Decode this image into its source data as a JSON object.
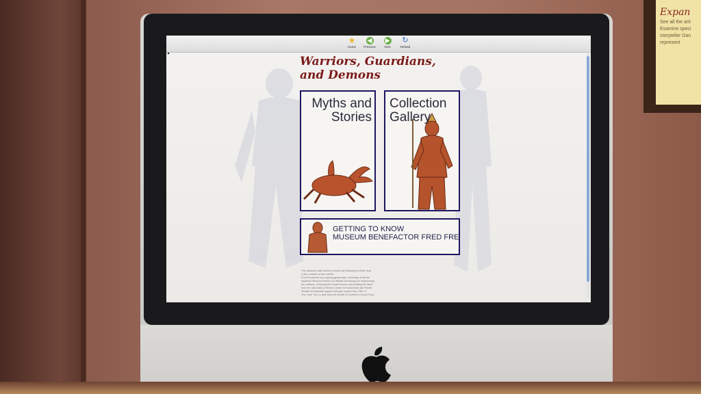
{
  "poster": {
    "title": "Expan",
    "lines": [
      "See all the arti",
      "Examine speci",
      "storyteller Dan",
      "represent"
    ]
  },
  "browser": {
    "toolbar": [
      {
        "label": "Home",
        "icon": "star-icon",
        "color": "#e8b82c"
      },
      {
        "label": "Previous",
        "icon": "back-arrow-icon",
        "color": "#6cb04c"
      },
      {
        "label": "Next",
        "icon": "forward-arrow-icon",
        "color": "#6cb04c"
      },
      {
        "label": "Reload",
        "icon": "reload-icon",
        "color": "#3a64c8"
      }
    ]
  },
  "page": {
    "title_line1": "Warriors, Guardians,",
    "title_line2": "and Demons",
    "myths": {
      "line1": "Myths and",
      "line2": "Stories"
    },
    "gallery": {
      "line1": "Collection",
      "line2": "Gallery"
    },
    "benefactor": {
      "line1": "GETTING TO KNOW",
      "line2": "MUSEUM BENEFACTOR FRED FREUND"
    },
    "credits": [
      "The Museum staff wishes to thank the following for their help",
      "in the creation of this exhibit:",
      "Fred Freund for his ongoing generosity; University of Illinois",
      "students Rebecca Ehlert and William Armstrong for researching",
      "the artifacts, choosing the exhibit theme, and drafting the label",
      "text; the University of Illinois Center for East Asian and Pacific",
      "Studies for financial support through a grant from Title VI.",
      "",
      "The Yuen Tze Lo and Gary De Monte La Scherer's Grand Fund"
    ]
  },
  "colors": {
    "title": "#7a1a1a",
    "panel_border": "#1c1560"
  }
}
